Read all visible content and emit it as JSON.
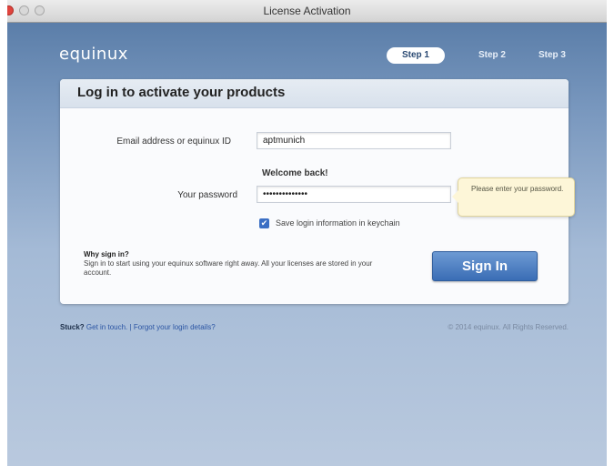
{
  "window": {
    "title": "License Activation"
  },
  "logo": {
    "text": "equinux"
  },
  "steps": [
    {
      "label": "Step 1",
      "active": true
    },
    {
      "label": "Step 2",
      "active": false
    },
    {
      "label": "Step 3",
      "active": false
    }
  ],
  "panel": {
    "heading": "Log in to activate your products",
    "email_label": "Email address or equinux ID",
    "email_value": "aptmunich",
    "welcome_text": "Welcome back!",
    "password_label": "Your password",
    "password_value": "••••••••••••••",
    "keychain_label": "Save login information in keychain",
    "keychain_checked": true,
    "tooltip_text": "Please enter your password.",
    "why_title": "Why sign in?",
    "why_text": "Sign in to start using your equinux software right away. All your licenses are stored in your account.",
    "signin_label": "Sign In"
  },
  "footer": {
    "stuck": "Stuck?",
    "contact_link": "Get in touch.",
    "separator": "|",
    "forgot_link": "Forgot your login details?",
    "copyright": "© 2014 equinux. All Rights Reserved."
  },
  "colors": {
    "accent": "#3a6db5",
    "background": "#aebfd8",
    "close_button": "#e0443e"
  }
}
